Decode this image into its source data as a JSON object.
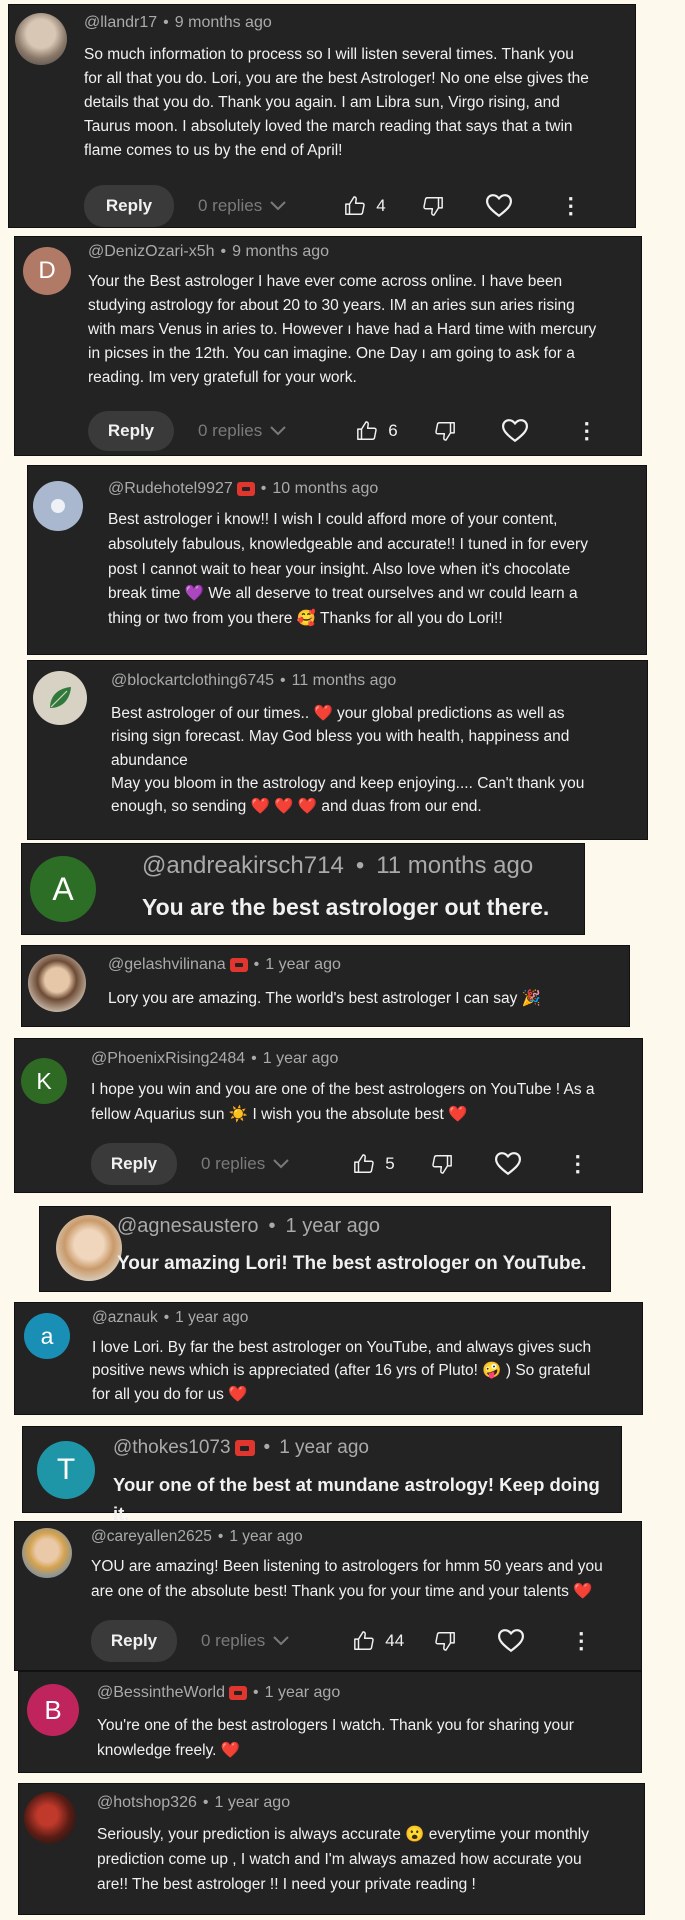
{
  "ui": {
    "reply_label": "Reply",
    "replies_label": "0 replies",
    "dot": "•",
    "more_glyph": "⋮",
    "chevron_glyph": "⌄",
    "heart_glyph": "♡"
  },
  "colors": {
    "page_bg": "#fdf9ec",
    "card_bg": "#232323",
    "badge": "#e0362e",
    "avatar_d": "#b07a66",
    "avatar_a_green": "#2c6e26",
    "avatar_k": "#2e6a24",
    "avatar_a_blue": "#1a8fb5",
    "avatar_t": "#1e96a8",
    "avatar_b": "#c0245d"
  },
  "comments": [
    {
      "handle": "@llandr17",
      "time": "9 months ago",
      "lines": [
        "So much information to process so I will listen several times. Thank you",
        "for all that you do. Lori, you are the best Astrologer! No one else gives the",
        "details that you do. Thank you again. I am Libra sun, Virgo rising, and",
        "Taurus moon. I absolutely loved the march reading that says that a twin",
        "flame comes to us by the end of April!"
      ],
      "likes": "4",
      "avatar_letter": ""
    },
    {
      "handle": "@DenizOzari-x5h",
      "time": "9 months ago",
      "lines": [
        "Your the Best astrologer I have ever come across online. I have been",
        "studying astrology for about 20 to 30 years. IM an aries sun aries rising",
        "with mars Venus in aries to. However ı have had a Hard time with mercury",
        "in picses in the 12th. You can imagine. One Day ı am going to ask for a",
        "reading. Im very gratefull for your work."
      ],
      "likes": "6",
      "avatar_letter": "D"
    },
    {
      "handle": "@Rudehotel9927",
      "time": "10 months ago",
      "lines": [
        "Best astrologer i know!! I wish I could afford more of your content,",
        "absolutely fabulous, knowledgeable and accurate!! I tuned in for every",
        "post I cannot wait to hear your insight. Also love when it's chocolate",
        "break time 💜  We all deserve to treat ourselves and wr could learn a",
        "thing or two from you there 🥰  Thanks for all you do Lori!!"
      ],
      "avatar_letter": ""
    },
    {
      "handle": "@blockartclothing6745",
      "time": "11 months ago",
      "lines": [
        "Best astrologer of our times.. ❤️  your global predictions as well as",
        "rising sign forecast. May God bless you with health, happiness and",
        "abundance",
        "May you bloom in the astrology and keep enjoying.... Can't thank you",
        "enough, so sending ❤️ ❤️ ❤️ and duas from our end."
      ],
      "avatar_letter": ""
    },
    {
      "handle": "@andreakirsch714",
      "time": "11 months ago",
      "lines": [
        "You are the best astrologer out there."
      ],
      "avatar_letter": "A"
    },
    {
      "handle": "@gelashvilinana",
      "time": "1 year ago",
      "lines": [
        "Lory you are amazing. The world's best astrologer I can say 🎉"
      ],
      "avatar_letter": ""
    },
    {
      "handle": "@PhoenixRising2484",
      "time": "1 year ago",
      "lines": [
        "I hope you win and you are one of the best astrologers on YouTube ! As a",
        "fellow Aquarius sun ☀️  I wish you the absolute best ❤️"
      ],
      "likes": "5",
      "avatar_letter": "K"
    },
    {
      "handle": "@agnesaustero",
      "time": "1 year ago",
      "lines": [
        "Your amazing Lori! The best astrologer on YouTube."
      ],
      "avatar_letter": ""
    },
    {
      "handle": "@aznauk",
      "time": "1 year ago",
      "lines": [
        "I love Lori. By far the best astrologer on YouTube, and always gives such",
        "positive news which is appreciated (after 16 yrs of Pluto! 🤪 ) So grateful",
        "for all you do for us ❤️"
      ],
      "avatar_letter": "a"
    },
    {
      "handle": "@thokes1073",
      "time": "1 year ago",
      "lines": [
        "Your one of the best at mundane astrology! Keep doing it."
      ],
      "avatar_letter": "T"
    },
    {
      "handle": "@careyallen2625",
      "time": "1 year ago",
      "lines": [
        "YOU are amazing! Been listening to astrologers for hmm 50 years and you",
        "are one of the absolute best! Thank you for your time and your talents ❤️"
      ],
      "likes": "44",
      "avatar_letter": ""
    },
    {
      "handle": "@BessintheWorld",
      "time": "1 year ago",
      "lines": [
        "You're one of the best astrologers I watch. Thank you for sharing your",
        "knowledge freely. ❤️"
      ],
      "avatar_letter": "B"
    },
    {
      "handle": "@hotshop326",
      "time": "1 year ago",
      "lines": [
        "Seriously, your prediction is always accurate 😮  everytime your monthly",
        "prediction come up , I watch and I'm always amazed how accurate you",
        "are!! The best astrologer !! I need your private reading !"
      ],
      "avatar_letter": ""
    }
  ]
}
